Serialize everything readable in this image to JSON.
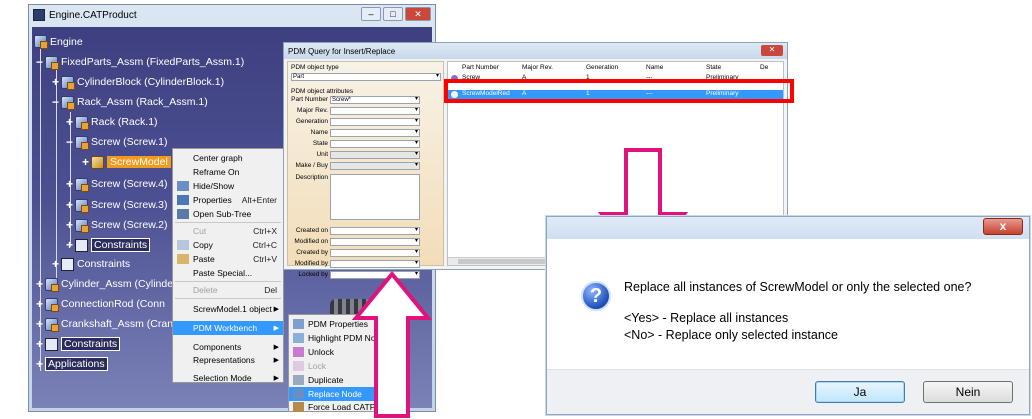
{
  "catia": {
    "title": "Engine.CATProduct",
    "tree": {
      "root": "Engine",
      "fixed_parts": "FixedParts_Assm (FixedParts_Assm.1)",
      "cylinder_block": "CylinderBlock (CylinderBlock.1)",
      "rack_assm": "Rack_Assm (Rack_Assm.1)",
      "rack": "Rack (Rack.1)",
      "screw1": "Screw (Screw.1)",
      "screw_model": "ScrewModel",
      "screw4": "Screw (Screw.4)",
      "screw3": "Screw (Screw.3)",
      "screw2": "Screw (Screw.2)",
      "constraints_inner": "Constraints",
      "constraints_outer": "Constraints",
      "cylinder_assm": "Cylinder_Assm (Cylinde",
      "connection_rod": "ConnectionRod (Conn",
      "crankshaft": "Crankshaft_Assm (Cran",
      "constraints_root": "Constraints",
      "applications": "Applications"
    },
    "context_menu": {
      "items": [
        {
          "label": "Center graph",
          "shortcut": ""
        },
        {
          "label": "Reframe On",
          "shortcut": ""
        },
        {
          "label": "Hide/Show",
          "shortcut": ""
        },
        {
          "label": "Properties",
          "shortcut": "Alt+Enter"
        },
        {
          "label": "Open Sub-Tree",
          "shortcut": ""
        },
        {
          "label": "Cut",
          "shortcut": "Ctrl+X"
        },
        {
          "label": "Copy",
          "shortcut": "Ctrl+C"
        },
        {
          "label": "Paste",
          "shortcut": "Ctrl+V"
        },
        {
          "label": "Paste Special...",
          "shortcut": ""
        },
        {
          "label": "Delete",
          "shortcut": "Del"
        },
        {
          "label": "ScrewModel.1 object",
          "shortcut": ""
        },
        {
          "label": "PDM Workbench",
          "shortcut": ""
        },
        {
          "label": "Components",
          "shortcut": ""
        },
        {
          "label": "Representations",
          "shortcut": ""
        },
        {
          "label": "Selection Mode",
          "shortcut": ""
        }
      ]
    },
    "pdm_submenu": {
      "items": [
        {
          "label": "PDM Properties"
        },
        {
          "label": "Highlight PDM Nodes"
        },
        {
          "label": "Unlock"
        },
        {
          "label": "Lock"
        },
        {
          "label": "Duplicate"
        },
        {
          "label": "Replace Node"
        },
        {
          "label": "Force Load CATPart"
        }
      ]
    }
  },
  "pdm_dialog": {
    "title": "PDM Query for Insert/Replace",
    "object_type_caption": "PDM object type",
    "object_type_value": "Part",
    "attributes_caption": "PDM object attributes",
    "fields": [
      {
        "label": "Part Number",
        "value": "Screw*"
      },
      {
        "label": "Major Rev.",
        "value": ""
      },
      {
        "label": "Generation",
        "value": ""
      },
      {
        "label": "Name",
        "value": ""
      },
      {
        "label": "State",
        "value": ""
      },
      {
        "label": "Unit",
        "value": ""
      },
      {
        "label": "Make / Buy",
        "value": ""
      },
      {
        "label": "Description",
        "value": ""
      }
    ],
    "fields2": [
      {
        "label": "Created on",
        "value": ""
      },
      {
        "label": "Modified on",
        "value": ""
      },
      {
        "label": "Created by",
        "value": ""
      },
      {
        "label": "Modified by",
        "value": ""
      },
      {
        "label": "Locked by",
        "value": ""
      }
    ],
    "columns": [
      "Part Number",
      "Major Rev.",
      "Generation",
      "Name",
      "State",
      "De"
    ],
    "rows": [
      {
        "part": "Screw",
        "rev": "A",
        "gen": "1",
        "name": "---",
        "state": "Preliminary"
      },
      {
        "part": "ScrewModelRed",
        "rev": "A",
        "gen": "1",
        "name": "---",
        "state": "Preliminary"
      }
    ]
  },
  "replace_dialog": {
    "close": "x",
    "question": "Replace all instances of ScrewModel or only the selected one?",
    "line_yes": "<Yes> - Replace all instances",
    "line_no": "<No> - Replace only selected instance",
    "yes_button": "Ja",
    "no_button": "Nein"
  },
  "colors": {
    "arrow": "#e0127b",
    "highlight_box": "#ff0000",
    "selection": "#3399ff"
  }
}
